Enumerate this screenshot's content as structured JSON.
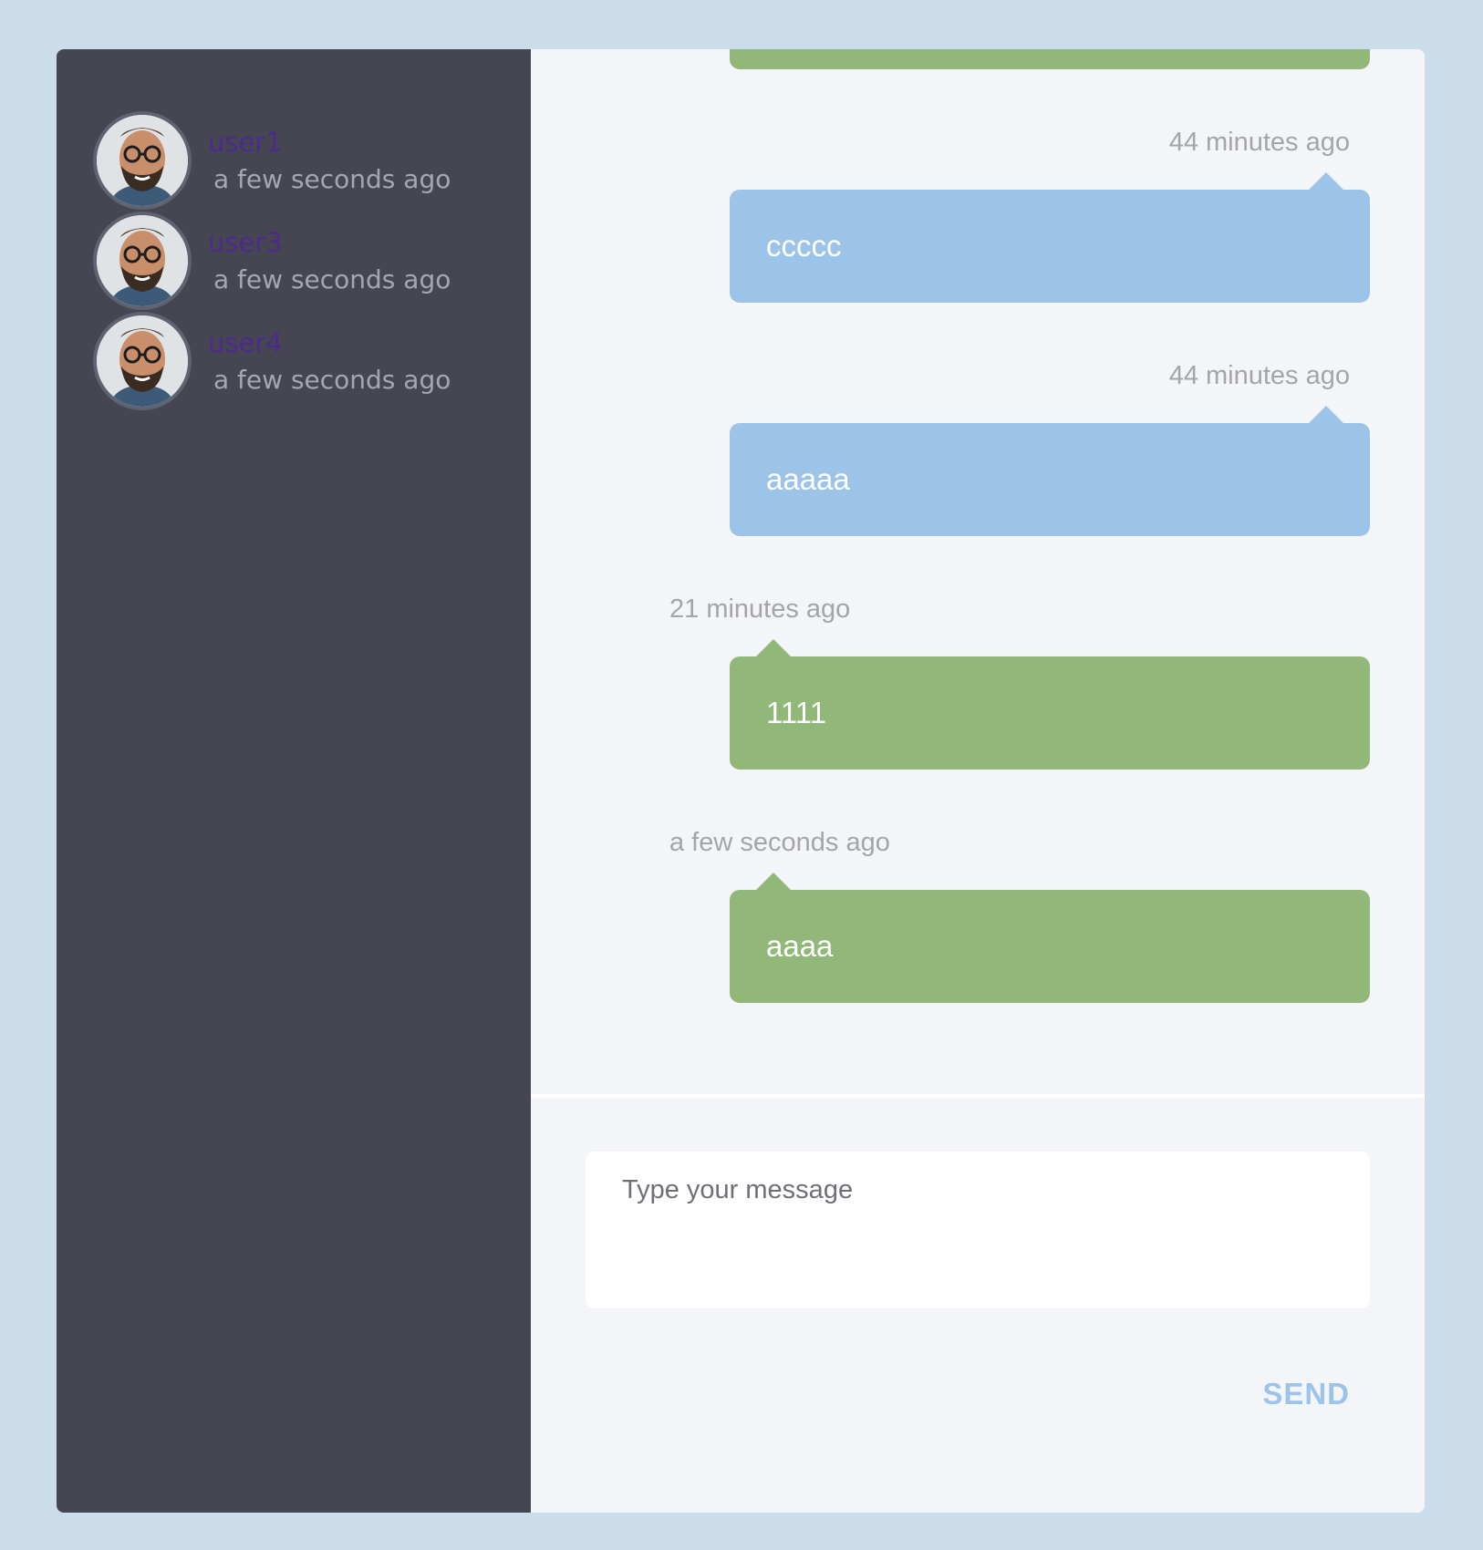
{
  "users": [
    {
      "name": "user1",
      "status": "a few seconds ago"
    },
    {
      "name": "user3",
      "status": "a few seconds ago"
    },
    {
      "name": "user4",
      "status": "a few seconds ago"
    }
  ],
  "messages": [
    {
      "side": "right",
      "time": "44 minutes ago",
      "text": "ccccc"
    },
    {
      "side": "right",
      "time": "44 minutes ago",
      "text": "aaaaa"
    },
    {
      "side": "left",
      "time": "21 minutes ago",
      "text": "1111"
    },
    {
      "side": "left",
      "time": "a few seconds ago",
      "text": "aaaa"
    }
  ],
  "composer": {
    "placeholder": "Type your message"
  },
  "send_label": "SEND",
  "colors": {
    "page_bg": "#cbdcea",
    "sidebar_bg": "#454652",
    "chat_bg": "#f4f5f9",
    "own_bubble": "#9cc3e8",
    "other_bubble": "#91b879",
    "username": "#4d2a8c"
  }
}
